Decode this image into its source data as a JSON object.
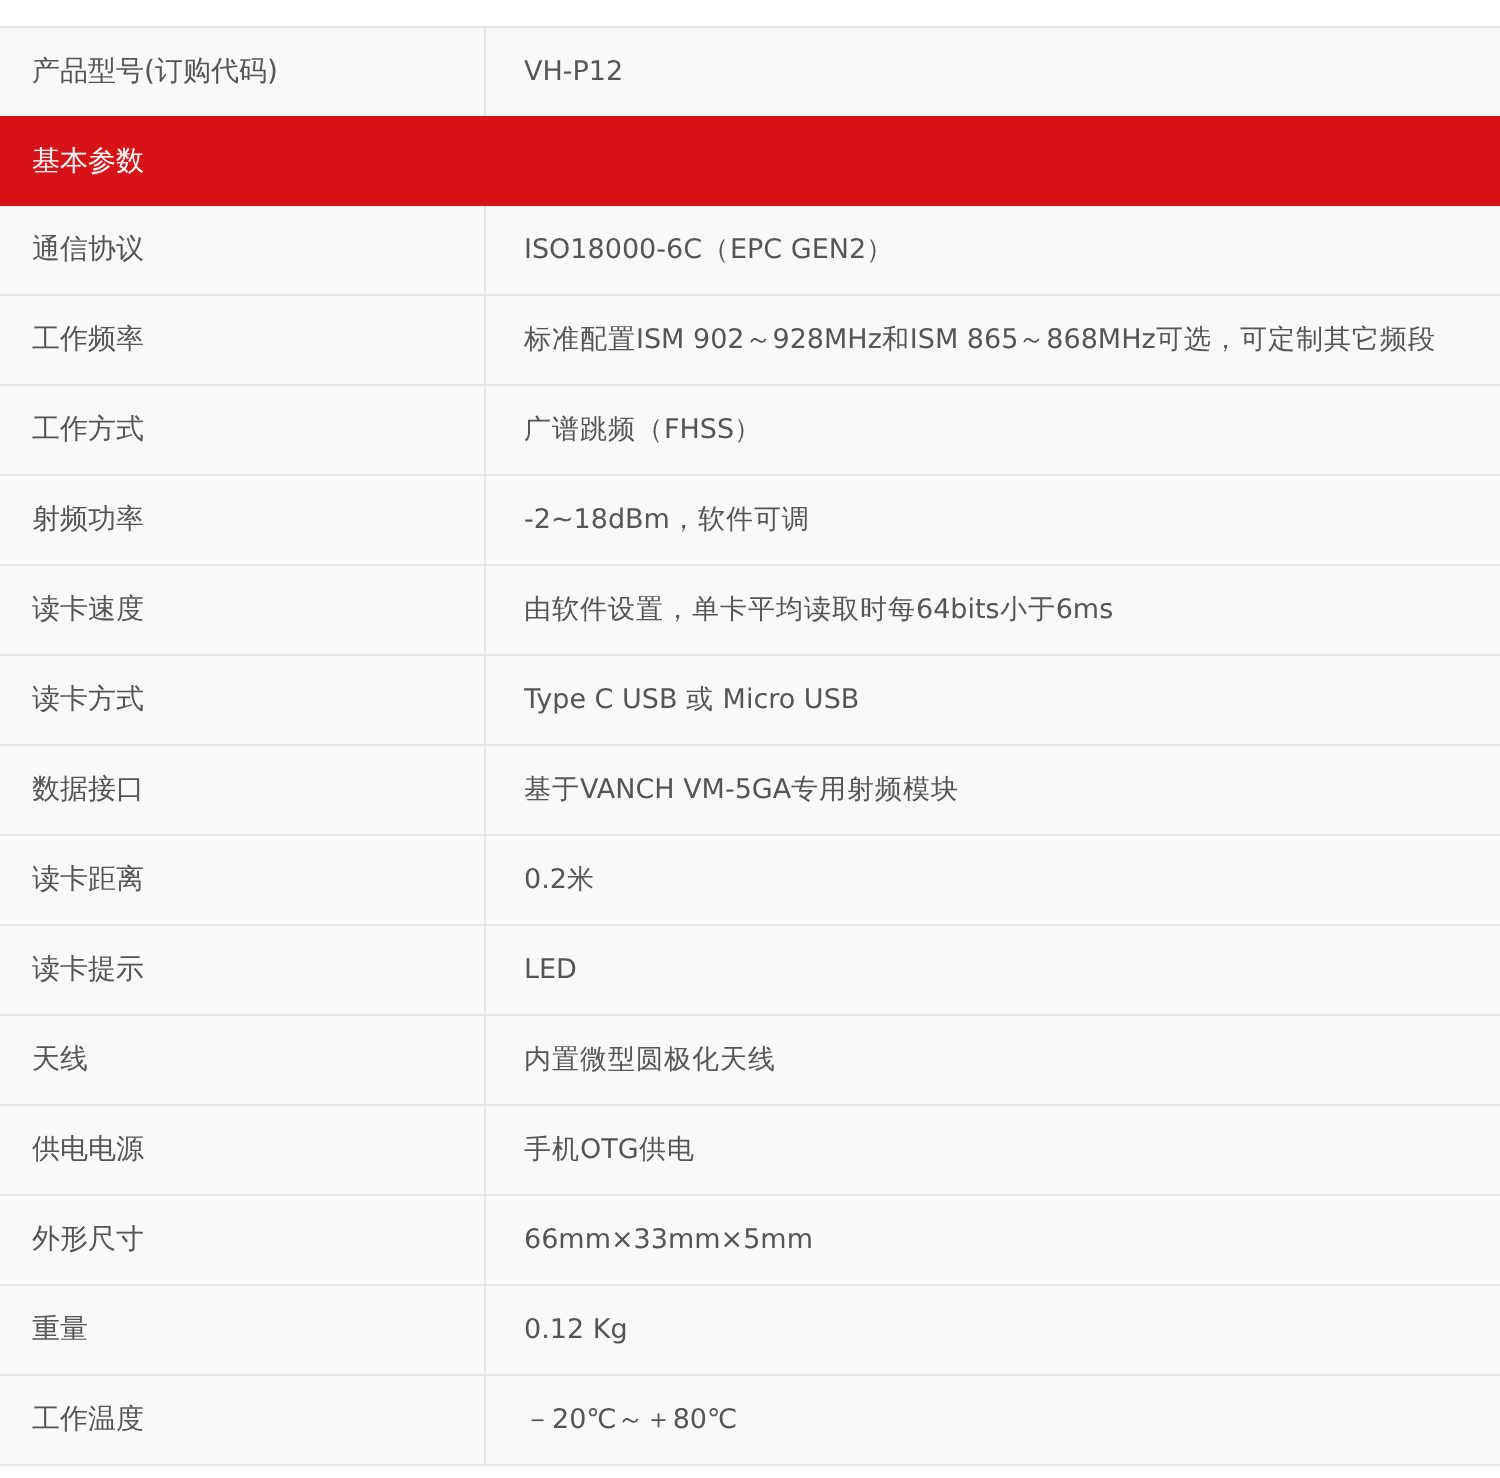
{
  "rows": [
    {
      "kind": "row",
      "label": "产品型号(订购代码)",
      "value": "VH-P12"
    },
    {
      "kind": "section",
      "label": "基本参数"
    },
    {
      "kind": "row",
      "label": "通信协议",
      "value": "ISO18000-6C（EPC GEN2）"
    },
    {
      "kind": "row",
      "label": "工作频率",
      "value": "标准配置ISM 902～928MHz和ISM 865～868MHz可选，可定制其它频段"
    },
    {
      "kind": "row",
      "label": "工作方式",
      "value": "广谱跳频（FHSS）"
    },
    {
      "kind": "row",
      "label": "射频功率",
      "value": "-2~18dBm，软件可调"
    },
    {
      "kind": "row",
      "label": "读卡速度",
      "value": "由软件设置，单卡平均读取时每64bits小于6ms"
    },
    {
      "kind": "row",
      "label": "读卡方式",
      "value": "Type C USB 或 Micro USB"
    },
    {
      "kind": "row",
      "label": "数据接口",
      "value": "基于VANCH VM-5GA专用射频模块"
    },
    {
      "kind": "row",
      "label": "读卡距离",
      "value": "0.2米"
    },
    {
      "kind": "row",
      "label": "读卡提示",
      "value": "LED"
    },
    {
      "kind": "row",
      "label": "天线",
      "value": "内置微型圆极化天线"
    },
    {
      "kind": "row",
      "label": "供电电源",
      "value": "手机OTG供电"
    },
    {
      "kind": "row",
      "label": "外形尺寸",
      "value": "66mm×33mm×5mm"
    },
    {
      "kind": "row",
      "label": "重量",
      "value": "0.12 Kg"
    },
    {
      "kind": "row",
      "label": "工作温度",
      "value": "－20℃～＋80℃"
    }
  ]
}
